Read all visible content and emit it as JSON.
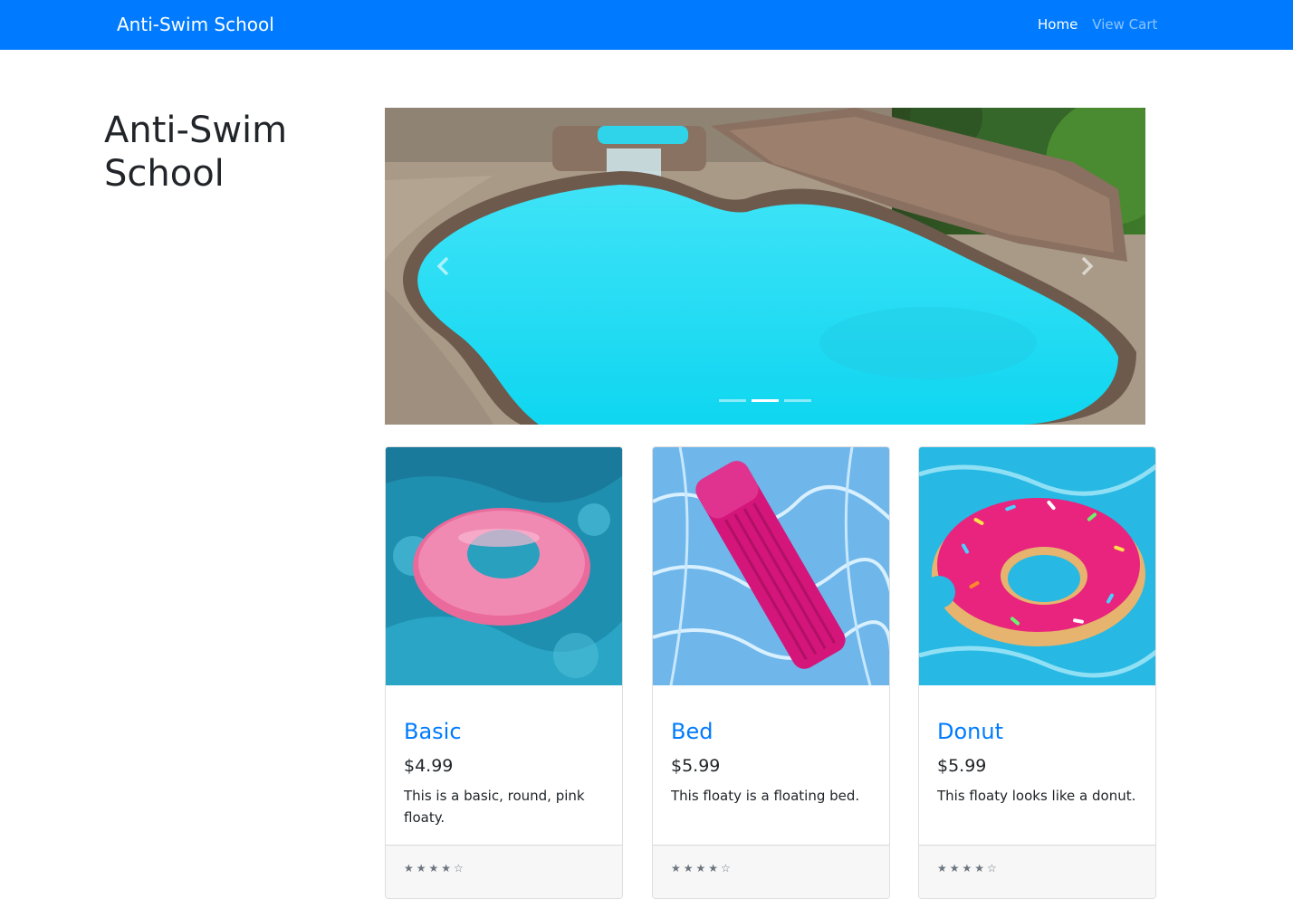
{
  "navbar": {
    "brand": "Anti-Swim School",
    "links": [
      {
        "label": "Home",
        "active": true
      },
      {
        "label": "View Cart",
        "active": false
      }
    ],
    "color": "#007bff"
  },
  "sidebar": {
    "title": "Anti-Swim School"
  },
  "carousel": {
    "slide_count": 3,
    "active_index": 1,
    "prev_icon": "chevron-left-icon",
    "next_icon": "chevron-right-icon"
  },
  "products": [
    {
      "name": "Basic",
      "price": "$4.99",
      "description": "This is a basic, round, pink floaty.",
      "rating": "★★★★☆"
    },
    {
      "name": "Bed",
      "price": "$5.99",
      "description": "This floaty is a floating bed.",
      "rating": "★★★★☆"
    },
    {
      "name": "Donut",
      "price": "$5.99",
      "description": "This floaty looks like a donut.",
      "rating": "★★★★☆"
    }
  ]
}
